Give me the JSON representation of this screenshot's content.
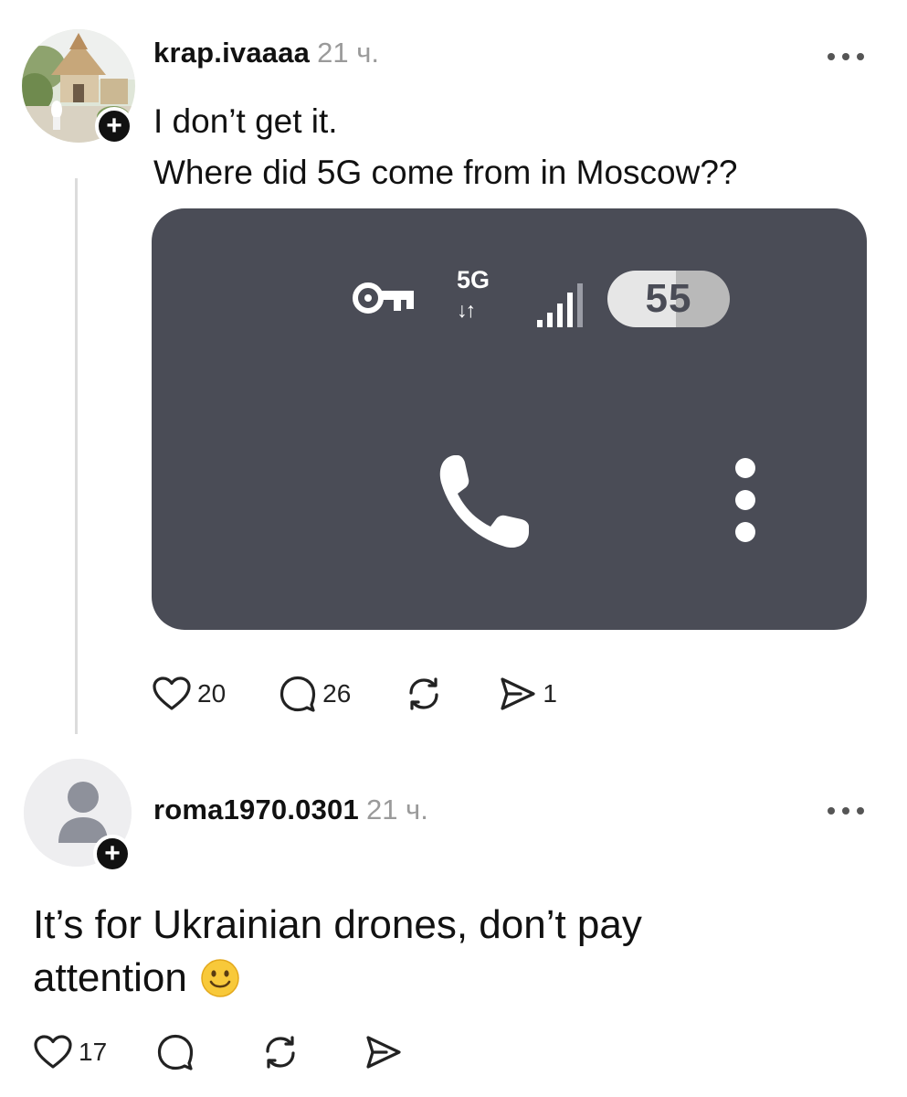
{
  "posts": [
    {
      "username": "krap.ivaaaa",
      "time": "21 ч.",
      "text_lines": [
        "I don’t get it.",
        "Where did 5G come from in Moscow??"
      ],
      "media": {
        "network_label": "5G",
        "network_arrows": "↓↑",
        "battery_level": "55",
        "icons": [
          "key-icon",
          "signal-bars-icon",
          "phone-icon",
          "vertical-dots-icon"
        ]
      },
      "actions": {
        "likes": "20",
        "comments": "26",
        "reposts": "",
        "shares": "1"
      },
      "follow_badge": "+"
    },
    {
      "username": "roma1970.0301",
      "time": "21 ч.",
      "text_lines": [
        "It’s for Ukrainian drones, don’t pay",
        "attention"
      ],
      "emoji": "slightly-smiling-face-icon",
      "actions": {
        "likes": "17",
        "comments": "",
        "reposts": "",
        "shares": ""
      },
      "follow_badge": "+"
    }
  ],
  "colors": {
    "media_background": "#4a4c56",
    "timestamp": "#9a9a9a",
    "text": "#111111"
  }
}
